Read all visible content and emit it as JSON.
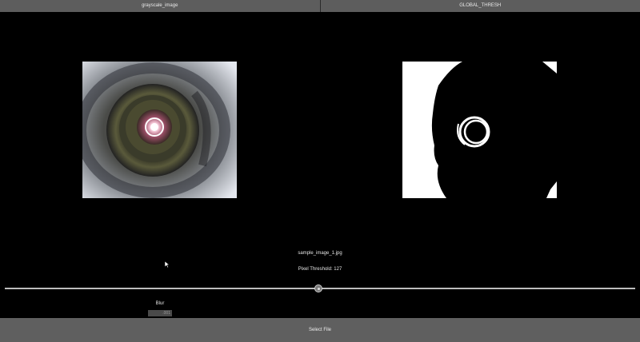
{
  "tabs": [
    {
      "label": "grayscale_image"
    },
    {
      "label": "GLOBAL_THRESH"
    }
  ],
  "file": {
    "name": "sample_image_1.jpg"
  },
  "threshold": {
    "label": "Pixel Threshold: 127",
    "value": 127,
    "max": 255
  },
  "blur": {
    "label": "Blur",
    "value": ".001"
  },
  "actions": {
    "select_file": "Select File"
  },
  "colors": {
    "tab": "#5d5d5d",
    "button": "#5f5f5f",
    "background": "#000000"
  }
}
